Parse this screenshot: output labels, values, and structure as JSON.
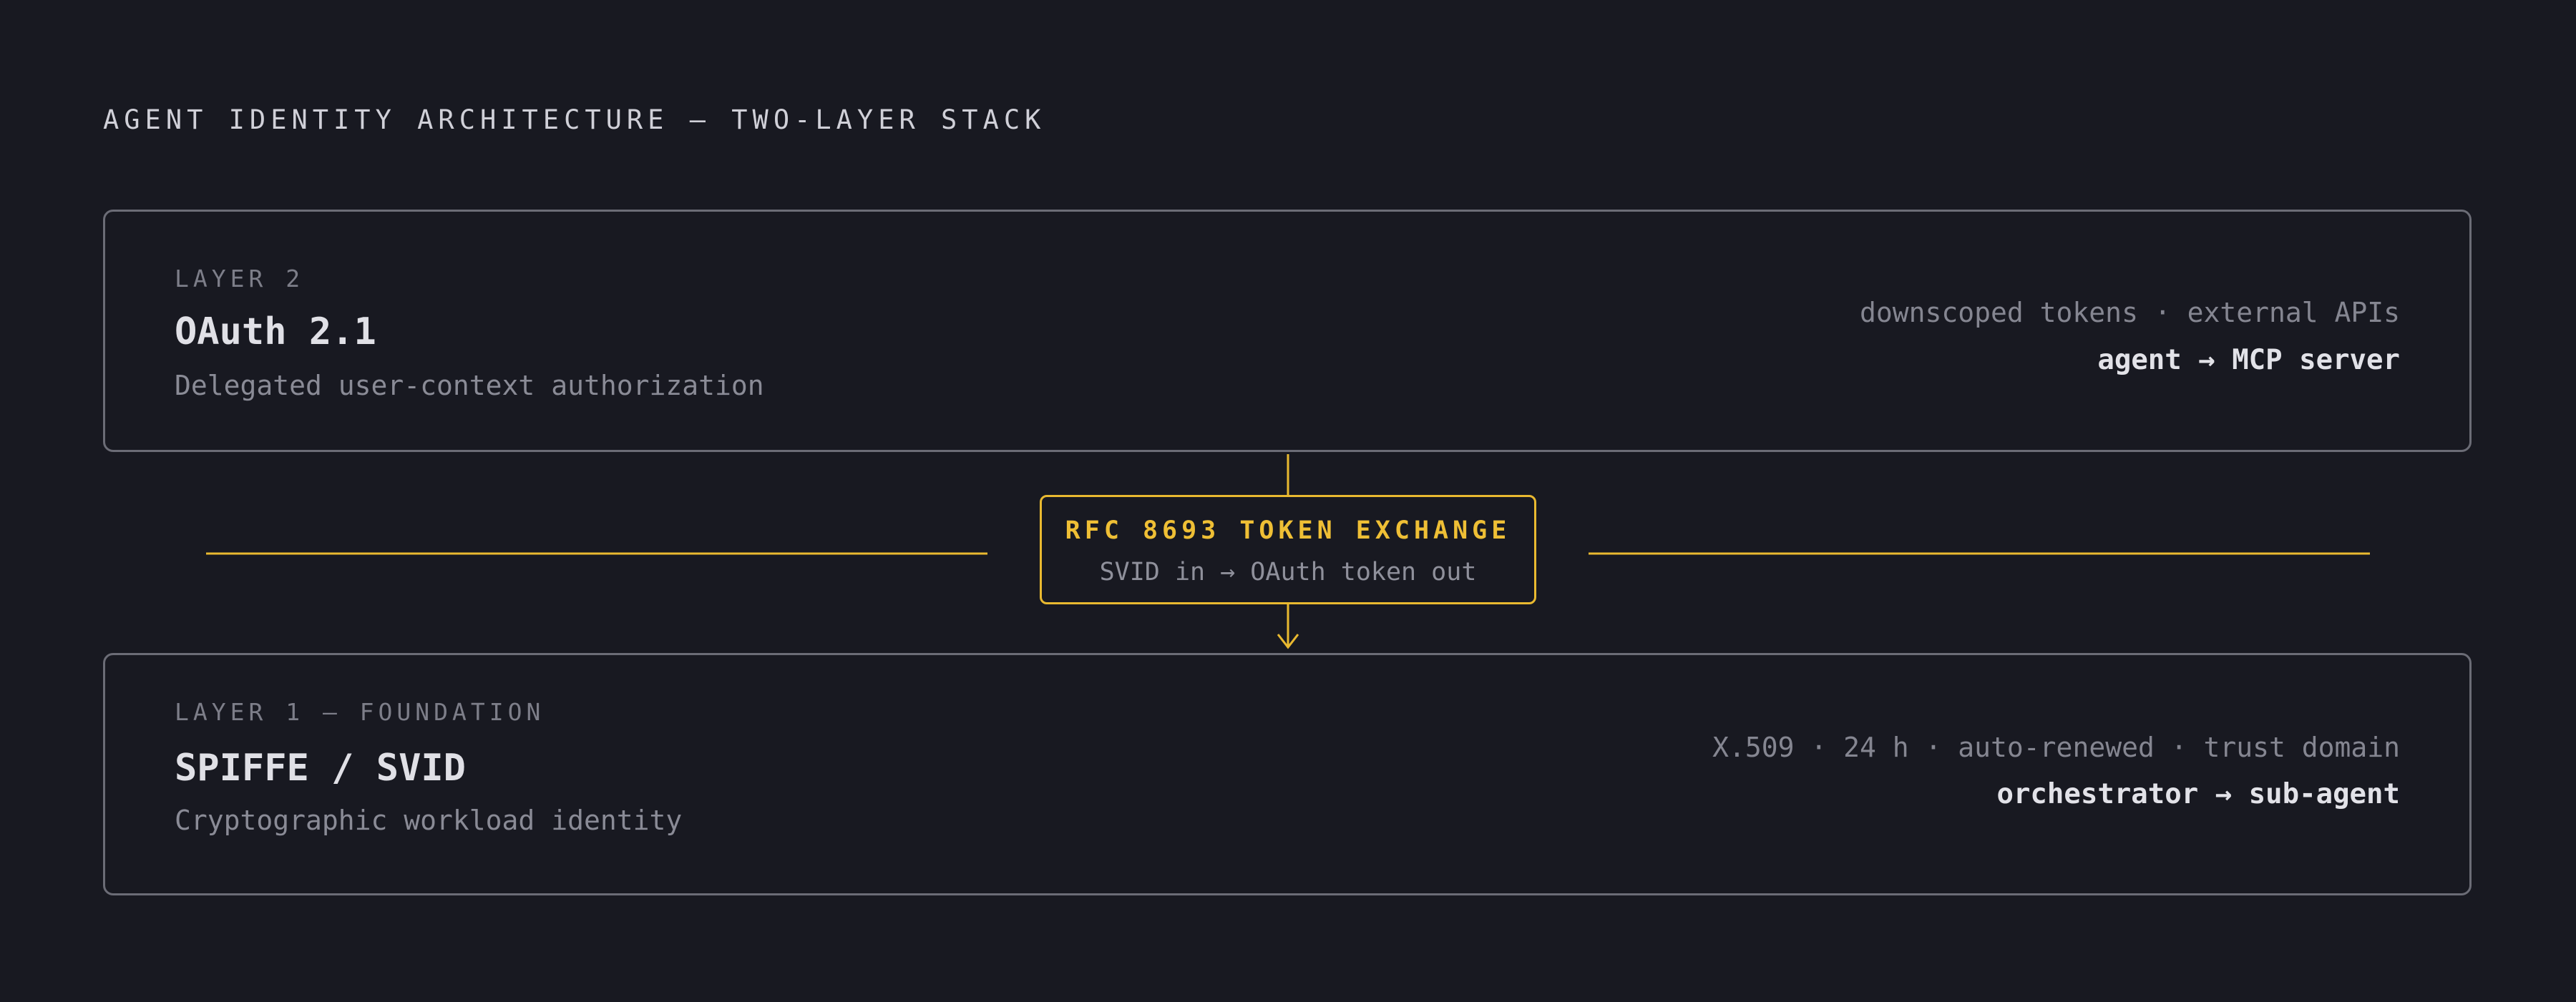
{
  "header": {
    "title": "AGENT IDENTITY ARCHITECTURE — TWO-LAYER STACK"
  },
  "layers": {
    "layer2": {
      "tag": "LAYER 2",
      "name": "OAuth 2.1",
      "description": "Delegated user-context authorization",
      "meta": "downscoped tokens · external APIs",
      "flow": "agent → MCP server"
    },
    "layer1": {
      "tag": "LAYER 1 — FOUNDATION",
      "name": "SPIFFE / SVID",
      "description": "Cryptographic workload identity",
      "meta": "X.509 · 24 h · auto-renewed · trust domain",
      "flow": "orchestrator → sub-agent"
    }
  },
  "exchange": {
    "title": "RFC 8693 TOKEN EXCHANGE",
    "subtitle": "SVID in → OAuth token out"
  },
  "colors": {
    "background": "#181921",
    "accent": "#e9b930",
    "border": "#6b6c76"
  }
}
